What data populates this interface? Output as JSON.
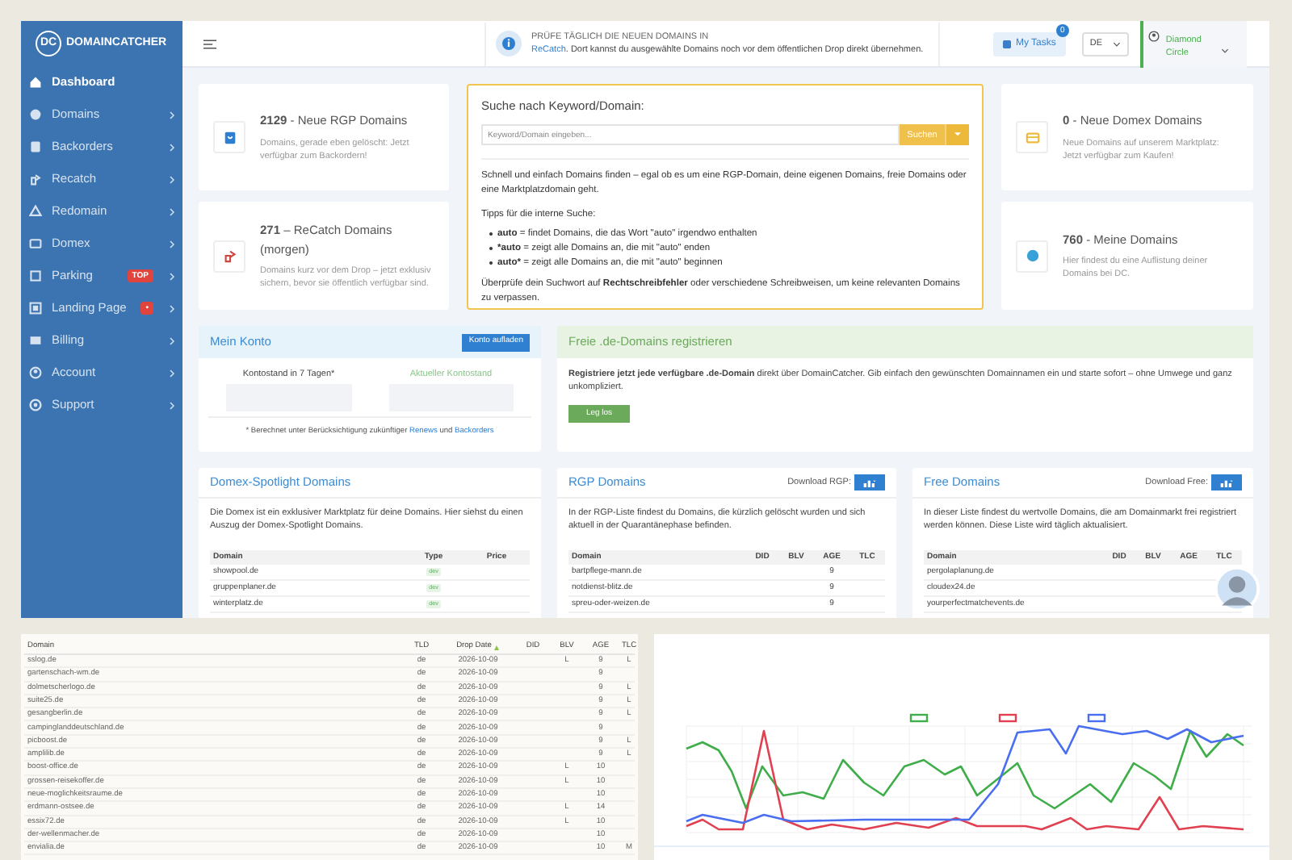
{
  "brand": {
    "logo": "DC",
    "name": "DOMAINCATCHER"
  },
  "sidebar": {
    "items": [
      {
        "label": "Dashboard",
        "selected": true,
        "submenu": false
      },
      {
        "label": "Domains",
        "selected": false,
        "submenu": true
      },
      {
        "label": "Backorders",
        "selected": false,
        "submenu": true
      },
      {
        "label": "Recatch",
        "selected": false,
        "submenu": true
      },
      {
        "label": "Redomain",
        "selected": false,
        "submenu": true
      },
      {
        "label": "Domex",
        "selected": false,
        "submenu": true
      },
      {
        "label": "Parking",
        "selected": false,
        "submenu": true,
        "badge": "TOP"
      },
      {
        "label": "Landing Page",
        "selected": false,
        "submenu": true,
        "badge": "•"
      },
      {
        "label": "Billing",
        "selected": false,
        "submenu": true
      },
      {
        "label": "Account",
        "selected": false,
        "submenu": true
      },
      {
        "label": "Support",
        "selected": false,
        "submenu": true
      }
    ]
  },
  "header": {
    "notice": {
      "title": "PRÜFE TÄGLICH DIE NEUEN DOMAINS IN",
      "parts": [
        {
          "kind": "link",
          "text": "ReCatch"
        },
        {
          "kind": "text",
          "text": ". Dort kannst du ausgewählte Domains noch vor dem öffentlichen Drop direkt übernehmen."
        }
      ]
    },
    "tasks": {
      "label": "My Tasks",
      "count": "0"
    },
    "language": "DE",
    "user": "Diamond Circle"
  },
  "stat_cards": [
    {
      "title": "**2129** - Neue RGP Domains",
      "text": "Domains, gerade eben gelöscht: Jetzt verfügbar zum Backordern!",
      "color": "#2f7fd0"
    },
    {
      "title": "**271** – ReCatch Domains (morgen)",
      "text": "Domains kurz vor dem Drop – jetzt exklusiv sichern, bevor sie öffentlich verfügbar sind.",
      "color": "#d0453c"
    },
    {
      "title": "**0** - Neue Domex Domains",
      "text": "Neue Domains auf unserem Marktplatz: Jetzt verfügbar zum Kaufen!",
      "color": "#efb93c"
    },
    {
      "title": "**760** - Meine Domains",
      "text": "Hier findest du eine Auflistung deiner Domains bei DC.",
      "color": "#3aa0d8"
    }
  ],
  "search": {
    "title": "Suche nach Keyword/Domain:",
    "placeholder": "Keyword/Domain eingeben...",
    "button": "Suchen",
    "intro": "Schnell und einfach Domains finden – egal ob es um eine RGP-Domain, deine eigenen Domains, freie Domains oder eine Marktplatzdomain geht.",
    "tips_title": "Tipps für die interne Suche:",
    "tips": [
      {
        "term": "auto",
        "text": "= findet Domains, die das Wort \"auto\" irgendwo enthalten"
      },
      {
        "term": "*auto",
        "text": "= zeigt alle Domains an, die mit \"auto\" enden"
      },
      {
        "term": "auto*",
        "text": "= zeigt alle Domains an, die mit \"auto\" beginnen"
      }
    ],
    "note": "Überprüfe dein Suchwort auf **Rechtschreibfehler** oder verschiedene Schreibweisen, um keine relevanten Domains zu verpassen."
  },
  "account": {
    "title": "Mein Konto",
    "button": "Konto aufladen",
    "balance_7_days": "Kontostand in 7 Tagen*",
    "balance_current": "Aktueller Kontostand",
    "footnote": [
      {
        "kind": "text",
        "text": "* Berechnet unter Berücksichtigung zukünftiger "
      },
      {
        "kind": "link",
        "text": "Renews"
      },
      {
        "kind": "text",
        "text": " und "
      },
      {
        "kind": "link",
        "text": "Backorders"
      }
    ]
  },
  "register": {
    "title": "Freie .de-Domains registrieren",
    "text": "**Registriere jetzt jede verfügbare .de-Domain** direkt über DomainCatcher. Gib einfach den gewünschten Domainnamen ein und starte sofort – ohne Umwege und ganz unkompliziert.",
    "button": "Leg los"
  },
  "domex": {
    "title": "Domex-Spotlight Domains",
    "text": "Die Domex ist ein exklusiver Marktplatz für deine Domains. Hier siehst du einen Auszug der Domex-Spotlight Domains.",
    "columns": [
      "Domain",
      "Type",
      "Price"
    ],
    "rows": [
      {
        "domain": "showpool.de",
        "type": "dev"
      },
      {
        "domain": "gruppenplaner.de",
        "type": "dev"
      },
      {
        "domain": "winterplatz.de",
        "type": "dev"
      }
    ]
  },
  "rgp": {
    "title": "RGP Domains",
    "download": "Download RGP:",
    "text": "In der RGP-Liste findest du Domains, die kürzlich gelöscht wurden und sich aktuell in der Quarantänephase befinden.",
    "columns": [
      "Domain",
      "DID",
      "BLV",
      "AGE",
      "TLC"
    ],
    "rows": [
      [
        "bartpflege-mann.de",
        "",
        "",
        "9",
        ""
      ],
      [
        "notdienst-blitz.de",
        "",
        "",
        "9",
        ""
      ],
      [
        "spreu-oder-weizen.de",
        "",
        "",
        "9",
        ""
      ]
    ]
  },
  "free": {
    "title": "Free Domains",
    "download": "Download Free:",
    "text": "In dieser Liste findest du wertvolle Domains, die am Domainmarkt frei registriert werden können. Diese Liste wird täglich aktualisiert.",
    "columns": [
      "Domain",
      "DID",
      "BLV",
      "AGE",
      "TLC"
    ],
    "rows": [
      [
        "pergolaplanung.de",
        "",
        "",
        "",
        ""
      ],
      [
        "cloudex24.de",
        "",
        "",
        "",
        ""
      ],
      [
        "yourperfectmatchevents.de",
        "",
        "",
        "",
        ""
      ]
    ]
  },
  "drop_table": {
    "columns": [
      {
        "label": "Domain",
        "sorted": false
      },
      {
        "label": "TLD",
        "sorted": false
      },
      {
        "label": "Drop Date",
        "sorted": true
      },
      {
        "label": "DID",
        "sorted": false
      },
      {
        "label": "BLV",
        "sorted": false
      },
      {
        "label": "AGE",
        "sorted": false
      },
      {
        "label": "TLC",
        "sorted": false
      }
    ],
    "rows": [
      [
        "sslog.de",
        "de",
        "2026-10-09",
        "",
        "L",
        "9",
        "L"
      ],
      [
        "gartenschach-wm.de",
        "de",
        "2026-10-09",
        "",
        "",
        "9",
        ""
      ],
      [
        "dolmetscherlogo.de",
        "de",
        "2026-10-09",
        "",
        "",
        "9",
        "L"
      ],
      [
        "suite25.de",
        "de",
        "2026-10-09",
        "",
        "",
        "9",
        "L"
      ],
      [
        "gesangberlin.de",
        "de",
        "2026-10-09",
        "",
        "",
        "9",
        "L"
      ],
      [
        "campinglanddeutschland.de",
        "de",
        "2026-10-09",
        "",
        "",
        "9",
        ""
      ],
      [
        "picboost.de",
        "de",
        "2026-10-09",
        "",
        "",
        "9",
        "L"
      ],
      [
        "amplilib.de",
        "de",
        "2026-10-09",
        "",
        "",
        "9",
        "L"
      ],
      [
        "boost-office.de",
        "de",
        "2026-10-09",
        "",
        "L",
        "10",
        ""
      ],
      [
        "grossen-reisekoffer.de",
        "de",
        "2026-10-09",
        "",
        "L",
        "10",
        ""
      ],
      [
        "neue-moglichkeitsraume.de",
        "de",
        "2026-10-09",
        "",
        "",
        "10",
        ""
      ],
      [
        "erdmann-ostsee.de",
        "de",
        "2026-10-09",
        "",
        "L",
        "14",
        ""
      ],
      [
        "essix72.de",
        "de",
        "2026-10-09",
        "",
        "L",
        "10",
        ""
      ],
      [
        "der-wellenmacher.de",
        "de",
        "2026-10-09",
        "",
        "",
        "10",
        ""
      ],
      [
        "envialia.de",
        "de",
        "2026-10-09",
        "",
        "",
        "10",
        "M"
      ]
    ]
  },
  "chart": {
    "series": [
      {
        "color": "#3fae4a"
      },
      {
        "color": "#e04050"
      },
      {
        "color": "#4a6ef0"
      }
    ]
  }
}
